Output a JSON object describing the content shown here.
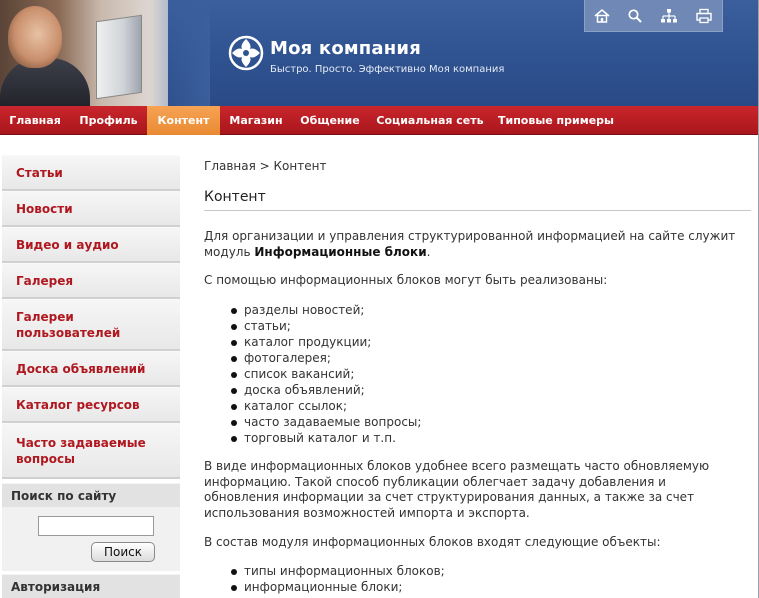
{
  "header": {
    "company_name": "Моя компания",
    "slogan": "Быстро. Просто. Эффективно Моя компания",
    "toolbar_icons": [
      "home-icon",
      "search-icon",
      "sitemap-icon",
      "print-icon"
    ]
  },
  "topnav": {
    "items": [
      {
        "label": "Главная"
      },
      {
        "label": "Профиль"
      },
      {
        "label": "Контент",
        "active": true
      },
      {
        "label": "Магазин"
      },
      {
        "label": "Общение"
      },
      {
        "label": "Социальная сеть"
      },
      {
        "label": "Типовые примеры"
      }
    ]
  },
  "sidebar": {
    "items": [
      {
        "label": "Статьи"
      },
      {
        "label": "Новости"
      },
      {
        "label": "Видео и аудио"
      },
      {
        "label": "Галерея"
      },
      {
        "label": "Галереи пользователей"
      },
      {
        "label": "Доска объявлений"
      },
      {
        "label": "Каталог ресурсов"
      },
      {
        "label": "Часто задаваемые вопросы"
      }
    ],
    "search_title": "Поиск по сайту",
    "search_value": "",
    "search_button": "Поиск",
    "auth_title": "Авторизация"
  },
  "content": {
    "breadcrumb": "Главная > Контент",
    "title": "Контент",
    "intro_text": "Для организации и управления структурированной информацией на сайте служит модуль ",
    "intro_bold": "Информационные блоки",
    "intro_end": ".",
    "para2": "С помощью информационных блоков могут быть реализованы:",
    "list1": [
      "разделы новостей;",
      "статьи;",
      "каталог продукции;",
      "фотогалерея;",
      "список вакансий;",
      "доска объявлений;",
      "каталог ссылок;",
      "часто задаваемые вопросы;",
      "торговый каталог и т.п."
    ],
    "para3": "В виде информационных блоков удобнее всего размещать часто обновляемую информацию. Такой способ публикации облегчает задачу добавления и обновления информации за счет структурирования данных, а также за счет использования возможностей импорта и экспорта.",
    "para4": "В состав модуля информационных блоков входят следующие объекты:",
    "list2": [
      "типы информационных блоков;",
      "информационные блоки;"
    ]
  },
  "colors": {
    "header_blue": "#2f5290",
    "nav_red": "#b81c22",
    "nav_active_orange": "#ee9440",
    "sidebar_link_red": "#b01820"
  }
}
